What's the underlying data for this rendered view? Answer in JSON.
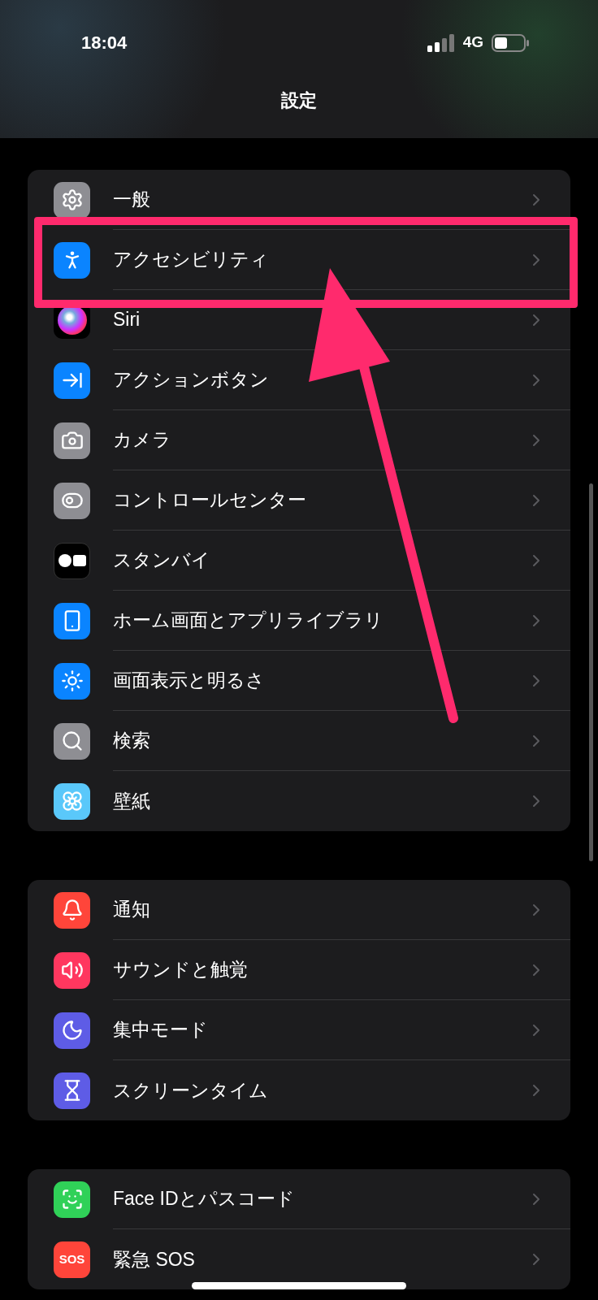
{
  "status_bar": {
    "time": "18:04",
    "network": "4G"
  },
  "title": "設定",
  "groups": [
    {
      "items": [
        {
          "label": "一般",
          "kind": "general",
          "color": "#8e8e93"
        },
        {
          "label": "アクセシビリティ",
          "kind": "accessibility",
          "color": "#0a84ff",
          "highlighted": true
        },
        {
          "label": "Siri",
          "kind": "siri",
          "color": "#000000"
        },
        {
          "label": "アクションボタン",
          "kind": "action",
          "color": "#0a84ff"
        },
        {
          "label": "カメラ",
          "kind": "camera",
          "color": "#8e8e93"
        },
        {
          "label": "コントロールセンター",
          "kind": "control",
          "color": "#8e8e93"
        },
        {
          "label": "スタンバイ",
          "kind": "standby",
          "color": "#000000"
        },
        {
          "label": "ホーム画面とアプリライブラリ",
          "kind": "home",
          "color": "#0a84ff"
        },
        {
          "label": "画面表示と明るさ",
          "kind": "display",
          "color": "#0a84ff"
        },
        {
          "label": "検索",
          "kind": "search",
          "color": "#8e8e93"
        },
        {
          "label": "壁紙",
          "kind": "wallpaper",
          "color": "#5ac8fa"
        }
      ]
    },
    {
      "items": [
        {
          "label": "通知",
          "kind": "notifications",
          "color": "#ff453a"
        },
        {
          "label": "サウンドと触覚",
          "kind": "sound",
          "color": "#ff375f"
        },
        {
          "label": "集中モード",
          "kind": "focus",
          "color": "#5e5ce6"
        },
        {
          "label": "スクリーンタイム",
          "kind": "screentime",
          "color": "#5e5ce6"
        }
      ]
    },
    {
      "items": [
        {
          "label": "Face IDとパスコード",
          "kind": "faceid",
          "color": "#30d158"
        },
        {
          "label": "緊急 SOS",
          "kind": "sos",
          "color": "#ff453a",
          "icon_text": "SOS"
        }
      ]
    }
  ],
  "annotation": {
    "arrow": true
  }
}
